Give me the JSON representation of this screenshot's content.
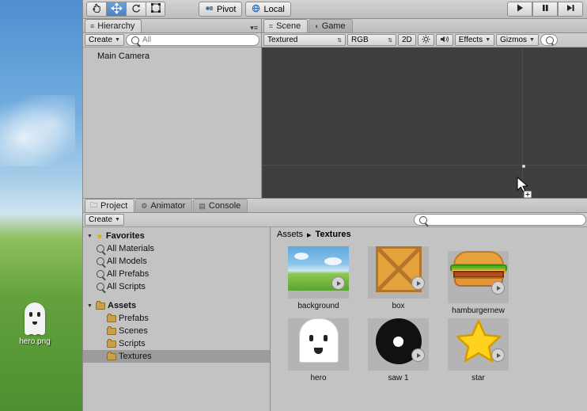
{
  "desktop": {
    "icon_label": "hero.png",
    "icon_name": "ghost-sprite"
  },
  "toolbar": {
    "tools": [
      {
        "name": "hand-tool",
        "glyph": "✋",
        "active": false
      },
      {
        "name": "move-tool",
        "glyph": "✥",
        "active": true
      },
      {
        "name": "rotate-tool",
        "glyph": "↻",
        "active": false
      },
      {
        "name": "scale-tool",
        "glyph": "⤢",
        "active": false
      }
    ],
    "pivot_label": "Pivot",
    "space_label": "Local",
    "play_label": "▶",
    "pause_label": "❚❚",
    "step_label": "▶❙"
  },
  "hierarchy": {
    "tab_label": "Hierarchy",
    "create_label": "Create",
    "search_placeholder": "All",
    "items": [
      {
        "label": "Main Camera"
      }
    ]
  },
  "scene": {
    "tabs": [
      {
        "label": "Scene",
        "selected": true
      },
      {
        "label": "Game",
        "selected": false
      }
    ],
    "draw_mode": "Textured",
    "color_mode": "RGB",
    "view_2d": "2D",
    "lighting_icon": "☀",
    "audio_icon": "🔊",
    "effects_label": "Effects",
    "gizmos_label": "Gizmos",
    "gizmo_search_placeholder": ""
  },
  "project": {
    "tabs": [
      {
        "label": "Project",
        "selected": true
      },
      {
        "label": "Animator",
        "selected": false
      },
      {
        "label": "Console",
        "selected": false
      }
    ],
    "create_label": "Create",
    "search_placeholder": "",
    "tree": [
      {
        "label": "Favorites",
        "indent": 0,
        "arrow": "▼",
        "icon": "star",
        "bold": true,
        "selected": false
      },
      {
        "label": "All Materials",
        "indent": 1,
        "arrow": "",
        "icon": "search",
        "bold": false,
        "selected": false
      },
      {
        "label": "All Models",
        "indent": 1,
        "arrow": "",
        "icon": "search",
        "bold": false,
        "selected": false
      },
      {
        "label": "All Prefabs",
        "indent": 1,
        "arrow": "",
        "icon": "search",
        "bold": false,
        "selected": false
      },
      {
        "label": "All Scripts",
        "indent": 1,
        "arrow": "",
        "icon": "search",
        "bold": false,
        "selected": false
      },
      {
        "label": "Assets",
        "indent": 0,
        "arrow": "▼",
        "icon": "folder",
        "bold": true,
        "selected": false
      },
      {
        "label": "Prefabs",
        "indent": 1,
        "arrow": "",
        "icon": "folder",
        "bold": false,
        "selected": false
      },
      {
        "label": "Scenes",
        "indent": 1,
        "arrow": "",
        "icon": "folder",
        "bold": false,
        "selected": false
      },
      {
        "label": "Scripts",
        "indent": 1,
        "arrow": "",
        "icon": "folder",
        "bold": false,
        "selected": false
      },
      {
        "label": "Textures",
        "indent": 1,
        "arrow": "",
        "icon": "folder",
        "bold": false,
        "selected": true
      }
    ],
    "breadcrumb": {
      "root": "Assets",
      "sep": "▸",
      "current": "Textures"
    },
    "assets": [
      {
        "label": "background",
        "kind": "background"
      },
      {
        "label": "box",
        "kind": "box"
      },
      {
        "label": "hamburgernew",
        "kind": "burger"
      },
      {
        "label": "hero",
        "kind": "hero"
      },
      {
        "label": "saw 1",
        "kind": "saw"
      },
      {
        "label": "star",
        "kind": "star"
      }
    ]
  },
  "colors": {
    "accent": "#4a82c4",
    "panel": "#c3c3c3",
    "scene_bg": "#3f3f3f",
    "selection": "#9c9c9c"
  }
}
